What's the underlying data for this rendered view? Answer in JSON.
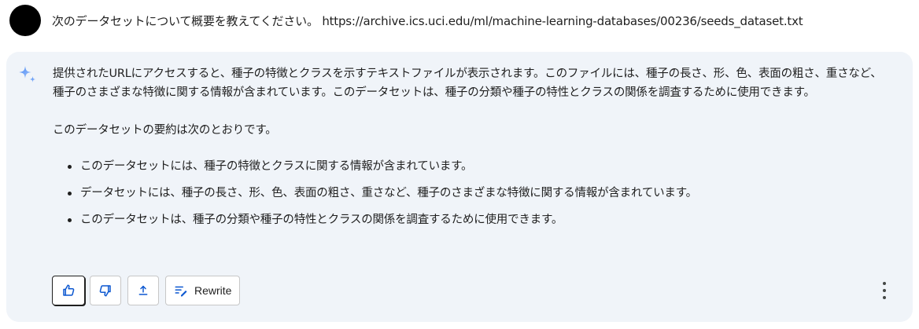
{
  "user": {
    "prompt": "次のデータセットについて概要を教えてください。 https://archive.ics.uci.edu/ml/machine-learning-databases/00236/seeds_dataset.txt"
  },
  "response": {
    "paragraph1": "提供されたURLにアクセスすると、種子の特徴とクラスを示すテキストファイルが表示されます。このファイルには、種子の長さ、形、色、表面の粗さ、重さなど、種子のさまざまな特徴に関する情報が含まれています。このデータセットは、種子の分類や種子の特性とクラスの関係を調査するために使用できます。",
    "paragraph2": "このデータセットの要約は次のとおりです。",
    "bullets": [
      "このデータセットには、種子の特徴とクラスに関する情報が含まれています。",
      "データセットには、種子の長さ、形、色、表面の粗さ、重さなど、種子のさまざまな特徴に関する情報が含まれています。",
      "このデータセットは、種子の分類や種子の特性とクラスの関係を調査するために使用できます。"
    ]
  },
  "actions": {
    "thumbs_up_icon": "thumbs-up-icon",
    "thumbs_down_icon": "thumbs-down-icon",
    "share_icon": "share-icon",
    "rewrite_icon": "rewrite-icon",
    "rewrite_label": "Rewrite",
    "more_icon": "more-vertical-icon"
  },
  "colors": {
    "card_background": "#f0f4f9",
    "accent": "#0b57d0",
    "sparkle_start": "#4285f4",
    "sparkle_end": "#a8c7fa"
  }
}
